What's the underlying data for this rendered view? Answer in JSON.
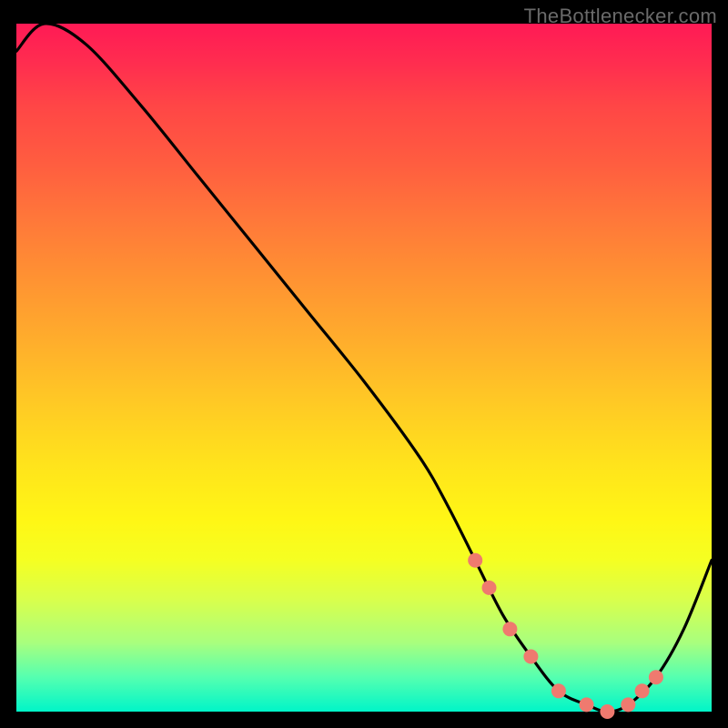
{
  "attribution": "TheBottlenecker.com",
  "chart_data": {
    "type": "line",
    "title": "",
    "xlabel": "",
    "ylabel": "",
    "xlim": [
      0,
      100
    ],
    "ylim": [
      0,
      100
    ],
    "series": [
      {
        "name": "bottleneck-curve",
        "x": [
          0,
          4,
          10,
          18,
          26,
          34,
          42,
          50,
          58,
          62,
          66,
          70,
          74,
          78,
          82,
          85,
          88,
          92,
          96,
          100
        ],
        "y": [
          96,
          100,
          97,
          88,
          78,
          68,
          58,
          48,
          37,
          30,
          22,
          14,
          8,
          3,
          1,
          0,
          1,
          5,
          12,
          22
        ]
      }
    ],
    "markers": {
      "name": "highlight-points",
      "color": "#ef7a6f",
      "points": [
        {
          "x": 66,
          "y": 22
        },
        {
          "x": 68,
          "y": 18
        },
        {
          "x": 71,
          "y": 12
        },
        {
          "x": 74,
          "y": 8
        },
        {
          "x": 78,
          "y": 3
        },
        {
          "x": 82,
          "y": 1
        },
        {
          "x": 85,
          "y": 0
        },
        {
          "x": 88,
          "y": 1
        },
        {
          "x": 90,
          "y": 3
        },
        {
          "x": 92,
          "y": 5
        }
      ]
    },
    "gradient_stops": [
      {
        "pos": 0,
        "color": "#ff1a55"
      },
      {
        "pos": 50,
        "color": "#ffcc24"
      },
      {
        "pos": 100,
        "color": "#00f5c8"
      }
    ]
  }
}
